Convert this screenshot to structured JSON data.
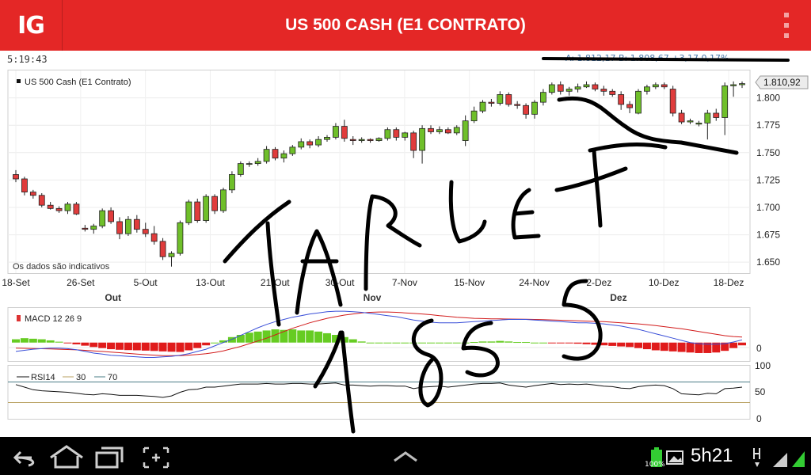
{
  "app": {
    "logo": "IG",
    "title": "US 500 CASH (E1 CONTRATO)",
    "time": "5:19:43",
    "quote_text": "A: 1.812,17 B: 1.808,67 +3,17 0,17%"
  },
  "chart_data": [
    {
      "type": "candlestick",
      "title": "US 500 Cash (E1 Contrato)",
      "note": "Os dados são indicativos",
      "last_value_label": "1.810,92",
      "ylim": [
        1640,
        1825
      ],
      "yticks": [
        1650,
        1675,
        1700,
        1725,
        1750,
        1775,
        1800
      ],
      "ytick_labels": [
        "1.650",
        "1.675",
        "1.700",
        "1.725",
        "1.750",
        "1.775",
        "1.800"
      ],
      "xtick_labels": [
        "18-Set",
        "26-Set",
        "5-Out",
        "13-Out",
        "21-Out",
        "30-Out",
        "7-Nov",
        "15-Nov",
        "24-Nov",
        "2-Dez",
        "10-Dez",
        "18-Dez"
      ],
      "month_labels": [
        "Out",
        "Nov",
        "Dez"
      ],
      "candles": [
        [
          1730,
          1734,
          1723,
          1726
        ],
        [
          1726,
          1728,
          1711,
          1714
        ],
        [
          1714,
          1716,
          1708,
          1711
        ],
        [
          1711,
          1713,
          1700,
          1702
        ],
        [
          1702,
          1705,
          1698,
          1699
        ],
        [
          1699,
          1701,
          1695,
          1697
        ],
        [
          1697,
          1705,
          1694,
          1703
        ],
        [
          1703,
          1705,
          1693,
          1694
        ],
        [
          1681,
          1684,
          1678,
          1680
        ],
        [
          1680,
          1685,
          1676,
          1683
        ],
        [
          1683,
          1699,
          1681,
          1697
        ],
        [
          1697,
          1700,
          1685,
          1687
        ],
        [
          1687,
          1691,
          1671,
          1676
        ],
        [
          1676,
          1692,
          1674,
          1689
        ],
        [
          1689,
          1693,
          1677,
          1680
        ],
        [
          1680,
          1686,
          1673,
          1676
        ],
        [
          1676,
          1683,
          1666,
          1669
        ],
        [
          1669,
          1672,
          1652,
          1655
        ],
        [
          1655,
          1660,
          1646,
          1658
        ],
        [
          1658,
          1688,
          1656,
          1686
        ],
        [
          1686,
          1707,
          1684,
          1705
        ],
        [
          1705,
          1708,
          1686,
          1688
        ],
        [
          1688,
          1712,
          1686,
          1710
        ],
        [
          1710,
          1712,
          1694,
          1697
        ],
        [
          1697,
          1718,
          1695,
          1716
        ],
        [
          1716,
          1733,
          1713,
          1730
        ],
        [
          1730,
          1742,
          1728,
          1740
        ],
        [
          1740,
          1742,
          1737,
          1740
        ],
        [
          1740,
          1745,
          1738,
          1742
        ],
        [
          1742,
          1756,
          1740,
          1753
        ],
        [
          1753,
          1755,
          1743,
          1745
        ],
        [
          1745,
          1752,
          1741,
          1749
        ],
        [
          1749,
          1757,
          1747,
          1755
        ],
        [
          1755,
          1763,
          1753,
          1760
        ],
        [
          1760,
          1762,
          1754,
          1757
        ],
        [
          1757,
          1765,
          1755,
          1762
        ],
        [
          1762,
          1766,
          1760,
          1764
        ],
        [
          1764,
          1777,
          1762,
          1774
        ],
        [
          1774,
          1780,
          1760,
          1763
        ],
        [
          1762,
          1765,
          1757,
          1761
        ],
        [
          1761,
          1764,
          1759,
          1762
        ],
        [
          1762,
          1763,
          1759,
          1761
        ],
        [
          1761,
          1764,
          1760,
          1763
        ],
        [
          1763,
          1773,
          1761,
          1771
        ],
        [
          1771,
          1773,
          1761,
          1764
        ],
        [
          1764,
          1769,
          1761,
          1768
        ],
        [
          1768,
          1770,
          1745,
          1752
        ],
        [
          1752,
          1775,
          1740,
          1772
        ],
        [
          1772,
          1775,
          1767,
          1769
        ],
        [
          1769,
          1774,
          1767,
          1771
        ],
        [
          1771,
          1773,
          1767,
          1768
        ],
        [
          1768,
          1775,
          1766,
          1773
        ],
        [
          1761,
          1784,
          1756,
          1779
        ],
        [
          1779,
          1792,
          1777,
          1788
        ],
        [
          1788,
          1798,
          1786,
          1796
        ],
        [
          1796,
          1799,
          1792,
          1795
        ],
        [
          1795,
          1806,
          1793,
          1803
        ],
        [
          1803,
          1805,
          1792,
          1794
        ],
        [
          1794,
          1797,
          1790,
          1793
        ],
        [
          1793,
          1795,
          1781,
          1785
        ],
        [
          1785,
          1798,
          1781,
          1796
        ],
        [
          1796,
          1808,
          1793,
          1805
        ],
        [
          1805,
          1814,
          1803,
          1812
        ],
        [
          1812,
          1815,
          1803,
          1806
        ],
        [
          1806,
          1810,
          1802,
          1808
        ],
        [
          1808,
          1813,
          1805,
          1810
        ],
        [
          1810,
          1815,
          1809,
          1812
        ],
        [
          1812,
          1814,
          1806,
          1808
        ],
        [
          1808,
          1811,
          1802,
          1806
        ],
        [
          1806,
          1808,
          1801,
          1803
        ],
        [
          1803,
          1806,
          1789,
          1794
        ],
        [
          1794,
          1797,
          1786,
          1791
        ],
        [
          1786,
          1808,
          1785,
          1806
        ],
        [
          1806,
          1812,
          1803,
          1810
        ],
        [
          1810,
          1814,
          1808,
          1812
        ],
        [
          1812,
          1814,
          1808,
          1810
        ],
        [
          1808,
          1811,
          1783,
          1786
        ],
        [
          1786,
          1789,
          1776,
          1778
        ],
        [
          1778,
          1781,
          1776,
          1779
        ],
        [
          1776,
          1779,
          1774,
          1777
        ],
        [
          1777,
          1789,
          1762,
          1786
        ],
        [
          1786,
          1790,
          1779,
          1782
        ],
        [
          1782,
          1814,
          1766,
          1811
        ],
        [
          1811,
          1815,
          1801,
          1812
        ],
        [
          1812,
          1815,
          1809,
          1813
        ]
      ]
    },
    {
      "type": "line",
      "title": "MACD 12 26 9",
      "zero_label": "0",
      "macd_values": [
        -8,
        -7,
        -6,
        -5.5,
        -5,
        -5,
        -5.5,
        -6.5,
        -8,
        -9.5,
        -10.5,
        -11.5,
        -12,
        -12.5,
        -13,
        -13.5,
        -13.5,
        -13,
        -12.5,
        -11.5,
        -10,
        -8,
        -6,
        -3,
        0,
        3,
        6.5,
        10,
        13.5,
        16.5,
        19,
        21,
        23,
        24.5,
        26,
        27,
        28,
        28.5,
        28.5,
        28,
        27.5,
        26.5,
        25.5,
        24.5,
        23.5,
        22,
        20.5,
        19.5,
        18.5,
        18,
        18,
        18,
        18.5,
        19,
        19.5,
        20,
        20.5,
        21,
        21,
        21,
        20.5,
        20,
        19.5,
        19,
        18.5,
        18,
        18,
        17.5,
        17,
        16,
        15,
        13.5,
        12,
        10,
        8,
        6,
        4,
        2,
        0,
        -1,
        -1.5,
        -1.5,
        -1,
        0.5,
        2.5
      ],
      "signal_values": [
        -5,
        -5.2,
        -5.4,
        -5.6,
        -5.8,
        -6,
        -6.3,
        -6.6,
        -7,
        -7.5,
        -8,
        -8.6,
        -9.2,
        -9.8,
        -10.4,
        -11,
        -11.4,
        -11.8,
        -11.9,
        -11.8,
        -11.4,
        -10.8,
        -10,
        -9,
        -7.5,
        -5.5,
        -3.5,
        -1,
        1.5,
        4,
        7,
        10,
        13,
        15.5,
        18,
        20,
        22,
        23.5,
        25,
        26,
        27,
        27.5,
        27.8,
        27.8,
        27.5,
        27,
        26.5,
        26,
        25.3,
        24.5,
        23.8,
        23,
        22.5,
        22,
        21.8,
        21.5,
        21.5,
        21.4,
        21.3,
        21.2,
        21,
        20.8,
        20.6,
        20.3,
        20,
        19.8,
        19.5,
        19.2,
        19,
        18.5,
        18,
        17.5,
        17,
        16.3,
        15.5,
        14.5,
        13.5,
        12.5,
        11.3,
        10,
        8.8,
        7.5,
        6.3,
        5.5,
        5
      ],
      "hist_values": [
        3,
        4,
        3.5,
        3,
        2,
        0.8,
        -0.4,
        -1.6,
        -2.8,
        -4,
        -5,
        -6,
        -6.5,
        -6.8,
        -7,
        -7.3,
        -7.6,
        -8,
        -8.3,
        -8.5,
        -7,
        -5,
        -2.5,
        0,
        2,
        5,
        7,
        9,
        10,
        11,
        12,
        11.5,
        12,
        11,
        11,
        10,
        8.5,
        7,
        5,
        3,
        1,
        0,
        0,
        0,
        0,
        0,
        0,
        0,
        0,
        0,
        0,
        0,
        0,
        0.5,
        1,
        1,
        1.5,
        1,
        0.5,
        0.5,
        0,
        0,
        -0.5,
        -0.5,
        -0.5,
        -1,
        -1.5,
        -2,
        -2.5,
        -3,
        -3.5,
        -4,
        -5,
        -6,
        -7,
        -7.5,
        -8,
        -8.5,
        -9,
        -9.5,
        -9.5,
        -9,
        -7.5,
        -5,
        -2.5
      ],
      "ylim": [
        -16,
        30
      ]
    },
    {
      "type": "line",
      "title": "RSI14",
      "legend": [
        "30",
        "70"
      ],
      "ytick_labels": [
        "100",
        "50",
        "0"
      ],
      "ylim": [
        0,
        100
      ],
      "rsi_values": [
        65,
        60,
        55,
        53,
        52,
        51,
        50,
        48,
        46,
        45,
        47,
        46,
        44,
        44,
        44,
        43,
        42,
        40,
        43,
        50,
        55,
        56,
        60,
        60,
        62,
        64,
        66,
        66,
        66,
        67,
        66,
        66,
        67,
        67,
        66,
        66,
        67,
        68,
        64,
        64,
        63,
        62,
        63,
        63,
        62,
        62,
        57,
        60,
        61,
        62,
        60,
        62,
        64,
        66,
        67,
        67,
        68,
        64,
        62,
        60,
        63,
        65,
        67,
        65,
        66,
        65,
        66,
        64,
        62,
        61,
        58,
        57,
        61,
        63,
        64,
        63,
        57,
        47,
        46,
        45,
        48,
        47,
        57,
        58,
        60
      ]
    }
  ],
  "system_bar": {
    "clock": "5h21",
    "battery": "100%"
  }
}
